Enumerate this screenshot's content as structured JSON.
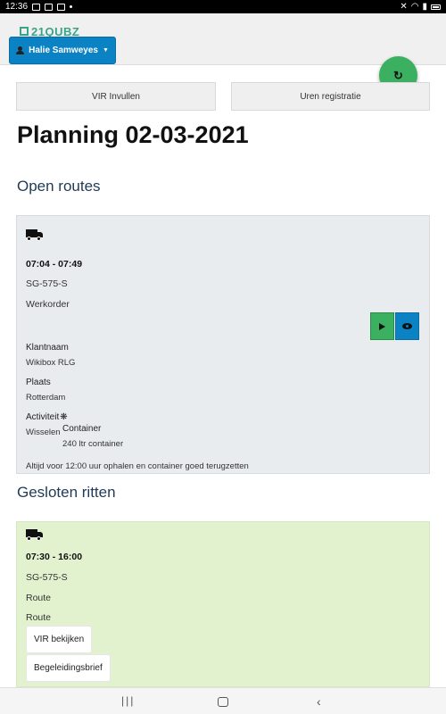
{
  "status_bar": {
    "time": "12:36"
  },
  "header": {
    "logo": "21QUBZ",
    "user": {
      "name": "Halie Samweyes"
    }
  },
  "actions": {
    "vir_label": "VIR Invullen",
    "uren_label": "Uren registratie",
    "refresh_icon": "refresh-icon"
  },
  "page": {
    "title": "Planning 02-03-2021"
  },
  "open_routes": {
    "title": "Open routes",
    "card": {
      "time": "07:04 - 07:49",
      "plate": "SG-575-S",
      "type": "Werkorder",
      "klantnaam_label": "Klantnaam",
      "klantnaam": "Wikibox RLG",
      "plaats_label": "Plaats",
      "plaats": "Rotterdam",
      "activiteit_label": "Activiteit",
      "activiteit": "Wisselen",
      "container_label": "Container",
      "container": "240 ltr container",
      "note": "Altijd voor 12:00 uur ophalen en container goed terugzetten"
    }
  },
  "closed_rides": {
    "title": "Gesloten ritten",
    "card": {
      "time": "07:30 - 16:00",
      "plate": "SG-575-S",
      "type": "Route",
      "subtype": "Route",
      "vir_button": "VIR bekijken",
      "letter_button": "Begeleidingsbrief"
    }
  },
  "colors": {
    "primary": "#0b82c4",
    "success": "#3bb060",
    "open_card_bg": "#e9ecef",
    "closed_card_bg": "#e2f2cf",
    "heading": "#1e3a56"
  }
}
